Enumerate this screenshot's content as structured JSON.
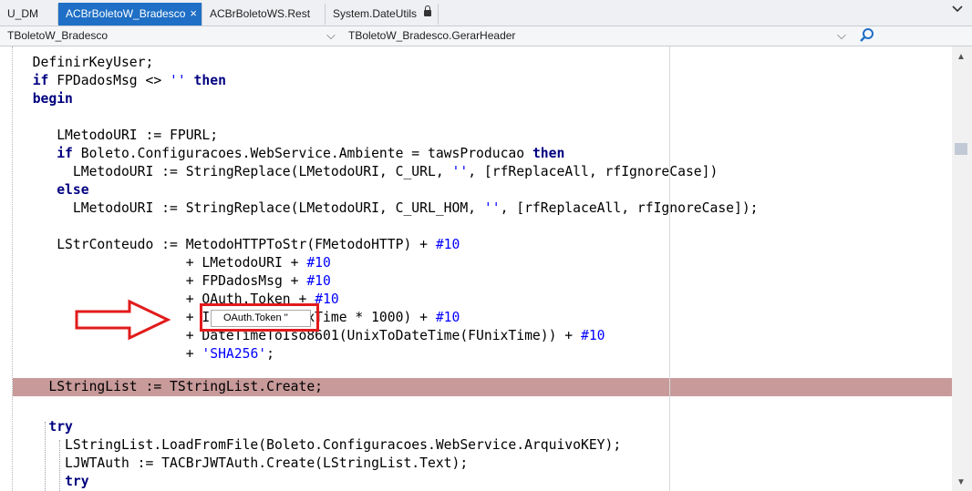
{
  "tabs": [
    {
      "label": "U_DM"
    },
    {
      "label": "ACBrBoletoW_Bradesco",
      "close": "×"
    },
    {
      "label": "ACBrBoletoWS.Rest"
    },
    {
      "label": "System.DateUtils"
    }
  ],
  "tab_overflow_icon": "chevron-down-icon",
  "nav": {
    "class_selector": "TBoletoW_Bradesco",
    "method_selector": "TBoletoW_Bradesco.GerarHeader",
    "dropdown_glyph": "⌵"
  },
  "code": {
    "lines": [
      [
        {
          "t": "  DefinirKeyUser;"
        }
      ],
      [
        {
          "t": "  "
        },
        {
          "t": "if",
          "c": "kw"
        },
        {
          "t": " FPDadosMsg <> "
        },
        {
          "t": "''",
          "c": "str"
        },
        {
          "t": " "
        },
        {
          "t": "then",
          "c": "kw"
        }
      ],
      [
        {
          "t": "  "
        },
        {
          "t": "begin",
          "c": "kw"
        }
      ],
      [
        {
          "t": ""
        }
      ],
      [
        {
          "t": "     LMetodoURI := FPURL;"
        }
      ],
      [
        {
          "t": "     "
        },
        {
          "t": "if",
          "c": "kw"
        },
        {
          "t": " Boleto.Configuracoes.WebService.Ambiente = tawsProducao "
        },
        {
          "t": "then",
          "c": "kw"
        }
      ],
      [
        {
          "t": "       LMetodoURI := StringReplace(LMetodoURI, C_URL, "
        },
        {
          "t": "''",
          "c": "str"
        },
        {
          "t": ", [rfReplaceAll, rfIgnoreCase])"
        }
      ],
      [
        {
          "t": "     "
        },
        {
          "t": "else",
          "c": "kw"
        }
      ],
      [
        {
          "t": "       LMetodoURI := StringReplace(LMetodoURI, C_URL_HOM, "
        },
        {
          "t": "''",
          "c": "str"
        },
        {
          "t": ", [rfReplaceAll, rfIgnoreCase]);"
        }
      ],
      [
        {
          "t": ""
        }
      ],
      [
        {
          "t": "     LStrConteudo := MetodoHTTPToStr(FMetodoHTTP) + "
        },
        {
          "t": "#10",
          "c": "num"
        }
      ],
      [
        {
          "t": "                     + LMetodoURI + "
        },
        {
          "t": "#10",
          "c": "num"
        }
      ],
      [
        {
          "t": "                     + FPDadosMsg + "
        },
        {
          "t": "#10",
          "c": "num"
        }
      ],
      [
        {
          "t": "                     + OAuth.Token + "
        },
        {
          "t": "#10",
          "c": "num"
        }
      ],
      [
        {
          "t": "                     + IntToStr(FUnixTime * 1000) + "
        },
        {
          "t": "#10",
          "c": "num"
        }
      ],
      [
        {
          "t": "                     + DateTimeToIso8601(UnixToDateTime(FUnixTime)) + "
        },
        {
          "t": "#10",
          "c": "num"
        }
      ],
      [
        {
          "t": "                     + "
        },
        {
          "t": "'SHA256'",
          "c": "str"
        },
        {
          "t": ";"
        }
      ],
      [
        {
          "t": ""
        }
      ],
      [
        {
          "t": "    LStringList := TStringList.Create;"
        }
      ],
      [
        {
          "t": ""
        }
      ],
      [
        {
          "t": "    "
        },
        {
          "t": "try",
          "c": "kw"
        }
      ],
      [
        {
          "t": "      LStringList.LoadFromFile(Boleto.Configuracoes.WebService.ArquivoKEY);"
        }
      ],
      [
        {
          "t": "      LJWTAuth := TACBrJWTAuth.Create(LStringList.Text);"
        }
      ],
      [
        {
          "t": "      "
        },
        {
          "t": "try",
          "c": "kw"
        }
      ]
    ]
  },
  "tooltip": {
    "text": "OAuth.Token     ''"
  },
  "colors": {
    "active_tab": "#1e6fc5",
    "keyword": "#000080",
    "string": "#0000ff",
    "highlight_row": "#c89a9a",
    "annotation": "#e21b1b"
  }
}
